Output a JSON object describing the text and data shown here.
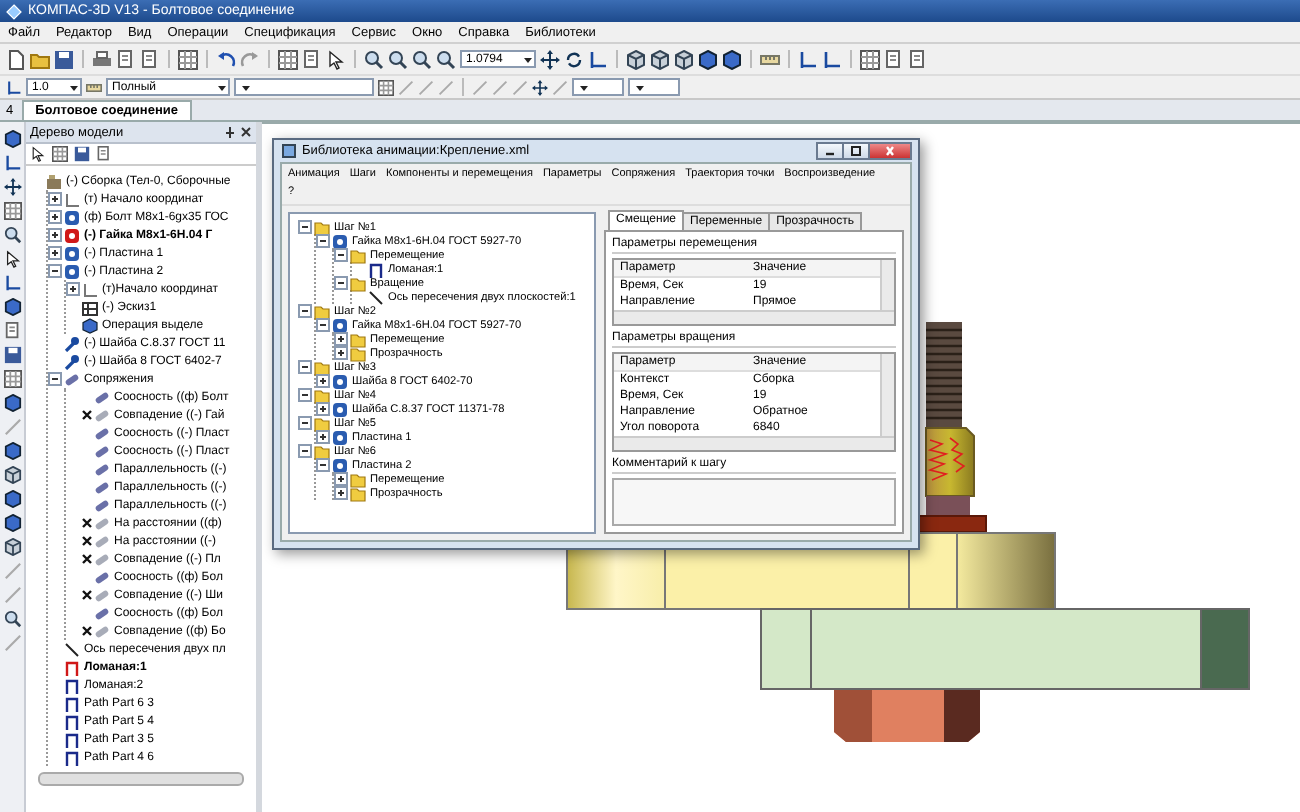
{
  "window": {
    "title": "КОМПАС-3D V13 - Болтовое соединение"
  },
  "menu": [
    "Файл",
    "Редактор",
    "Вид",
    "Операции",
    "Спецификация",
    "Сервис",
    "Окно",
    "Справка",
    "Библиотеки"
  ],
  "toolbar": {
    "zoom": "1.0794",
    "step": "1.0",
    "mode": "Полный"
  },
  "doc_tabs": {
    "marker": "4",
    "tabs": [
      {
        "label": "Болтовое соединение",
        "selected": true
      }
    ]
  },
  "model_tree": {
    "title": "Дерево модели",
    "items": [
      {
        "label": "(-) Сборка (Тел-0, Сборочные",
        "kind": "assembly",
        "active": false,
        "children": [
          {
            "label": "(т) Начало координат",
            "kind": "origin",
            "active": false,
            "expanded": false
          },
          {
            "label": "(ф) Болт М8х1-6gх35 ГОС",
            "kind": "part",
            "active": false,
            "expanded": false
          },
          {
            "label": "(-) Гайка М8х1-6Н.04 Г",
            "kind": "part",
            "active": true,
            "expanded": false
          },
          {
            "label": "(-) Пластина 1",
            "kind": "part",
            "active": false,
            "expanded": false
          },
          {
            "label": "(-) Пластина 2",
            "kind": "part",
            "active": false,
            "expanded": true,
            "children": [
              {
                "label": "(т)Начало координат",
                "kind": "origin",
                "active": false,
                "expanded": false
              },
              {
                "label": "(-) Эскиз1",
                "kind": "sketch",
                "active": false
              },
              {
                "label": "Операция выделе",
                "kind": "operation",
                "active": false
              }
            ]
          },
          {
            "label": "(-) Шайба С.8.37 ГОСТ 11",
            "kind": "washer",
            "active": false
          },
          {
            "label": "(-) Шайба 8 ГОСТ 6402-7",
            "kind": "washer",
            "active": false
          },
          {
            "label": "Сопряжения",
            "kind": "mates",
            "active": false,
            "expanded": true,
            "children": [
              {
                "label": "Соосность ((ф) Болт",
                "kind": "constraint",
                "active": false,
                "warning": false
              },
              {
                "label": "Совпадение ((-) Гай",
                "kind": "constraint",
                "active": false,
                "warning": true
              },
              {
                "label": "Соосность ((-) Пласт",
                "kind": "constraint",
                "active": false,
                "warning": false
              },
              {
                "label": "Соосность ((-) Пласт",
                "kind": "constraint",
                "active": false,
                "warning": false
              },
              {
                "label": "Параллельность ((-)",
                "kind": "constraint",
                "active": false,
                "warning": false
              },
              {
                "label": "Параллельность ((-)",
                "kind": "constraint",
                "active": false,
                "warning": false
              },
              {
                "label": "Параллельность ((-)",
                "kind": "constraint",
                "active": false,
                "warning": false
              },
              {
                "label": "На расстоянии ((ф)",
                "kind": "constraint",
                "active": false,
                "warning": true
              },
              {
                "label": "На расстоянии ((-)",
                "kind": "constraint",
                "active": false,
                "warning": true
              },
              {
                "label": "Совпадение ((-) Пл",
                "kind": "constraint",
                "active": false,
                "warning": true
              },
              {
                "label": "Соосность ((ф) Бол",
                "kind": "constraint",
                "active": false,
                "warning": false
              },
              {
                "label": "Совпадение ((-) Ши",
                "kind": "constraint",
                "active": false,
                "warning": true
              },
              {
                "label": "Соосность ((ф) Бол",
                "kind": "constraint",
                "active": false,
                "warning": false
              },
              {
                "label": "Совпадение ((ф) Бо",
                "kind": "constraint",
                "active": false,
                "warning": true
              }
            ]
          },
          {
            "label": "Ось пересечения двух пл",
            "kind": "axis",
            "active": false
          },
          {
            "label": "Ломаная:1",
            "kind": "polyline",
            "active": true
          },
          {
            "label": "Ломаная:2",
            "kind": "polyline",
            "active": false
          },
          {
            "label": "Path Part 6 3",
            "kind": "polyline",
            "active": false
          },
          {
            "label": "Path Part 5 4",
            "kind": "polyline",
            "active": false
          },
          {
            "label": "Path Part 3 5",
            "kind": "polyline",
            "active": false
          },
          {
            "label": "Path Part 4 6",
            "kind": "polyline",
            "active": false
          }
        ]
      }
    ]
  },
  "dialog": {
    "title": "Библиотека анимации:Крепление.xml",
    "menu": [
      "Анимация",
      "Шаги",
      "Компоненты и перемещения",
      "Параметры",
      "Сопряжения",
      "Траектория точки",
      "Воспроизведение",
      "?"
    ],
    "tree": [
      {
        "label": "Шаг №1",
        "kind": "folder",
        "expanded": true,
        "children": [
          {
            "label": "Гайка М8х1-6Н.04 ГОСТ 5927-70",
            "kind": "part",
            "expanded": true,
            "children": [
              {
                "label": "Перемещение",
                "kind": "folder",
                "expanded": true,
                "children": [
                  {
                    "label": "Ломаная:1",
                    "kind": "polyline"
                  }
                ]
              },
              {
                "label": "Вращение",
                "kind": "folder",
                "expanded": true,
                "children": [
                  {
                    "label": "Ось пересечения двух плоскостей:1",
                    "kind": "axis"
                  }
                ]
              }
            ]
          }
        ]
      },
      {
        "label": "Шаг №2",
        "kind": "folder",
        "expanded": true,
        "children": [
          {
            "label": "Гайка М8х1-6Н.04 ГОСТ 5927-70",
            "kind": "part",
            "expanded": true,
            "children": [
              {
                "label": "Перемещение",
                "kind": "folder",
                "expanded": false
              },
              {
                "label": "Прозрачность",
                "kind": "folder",
                "expanded": false
              }
            ]
          }
        ]
      },
      {
        "label": "Шаг №3",
        "kind": "folder",
        "expanded": true,
        "children": [
          {
            "label": "Шайба 8 ГОСТ 6402-70",
            "kind": "part",
            "expanded": false
          }
        ]
      },
      {
        "label": "Шаг №4",
        "kind": "folder",
        "expanded": true,
        "children": [
          {
            "label": "Шайба С.8.37 ГОСТ 11371-78",
            "kind": "part",
            "expanded": false
          }
        ]
      },
      {
        "label": "Шаг №5",
        "kind": "folder",
        "expanded": true,
        "children": [
          {
            "label": "Пластина 1",
            "kind": "part",
            "expanded": false
          }
        ]
      },
      {
        "label": "Шаг №6",
        "kind": "folder",
        "expanded": true,
        "children": [
          {
            "label": "Пластина 2",
            "kind": "part",
            "expanded": true,
            "children": [
              {
                "label": "Перемещение",
                "kind": "folder",
                "expanded": false
              },
              {
                "label": "Прозрачность",
                "kind": "folder",
                "expanded": false
              }
            ]
          }
        ]
      }
    ],
    "tabs": [
      {
        "label": "Смещение",
        "selected": true
      },
      {
        "label": "Переменные",
        "selected": false
      },
      {
        "label": "Прозрачность",
        "selected": false
      }
    ],
    "move_params": {
      "title": "Параметры перемещения",
      "columns": [
        "Параметр",
        "Значение"
      ],
      "rows": [
        [
          "Время, Сек",
          "19"
        ],
        [
          "Направление",
          "Прямое"
        ]
      ]
    },
    "rotate_params": {
      "title": "Параметры вращения",
      "columns": [
        "Параметр",
        "Значение"
      ],
      "rows": [
        [
          "Контекст",
          "Сборка"
        ],
        [
          "Время, Сек",
          "19"
        ],
        [
          "Направление",
          "Обратное"
        ],
        [
          "Угол поворота",
          "6840"
        ]
      ]
    },
    "comment": {
      "label": "Комментарий к шагу"
    }
  }
}
